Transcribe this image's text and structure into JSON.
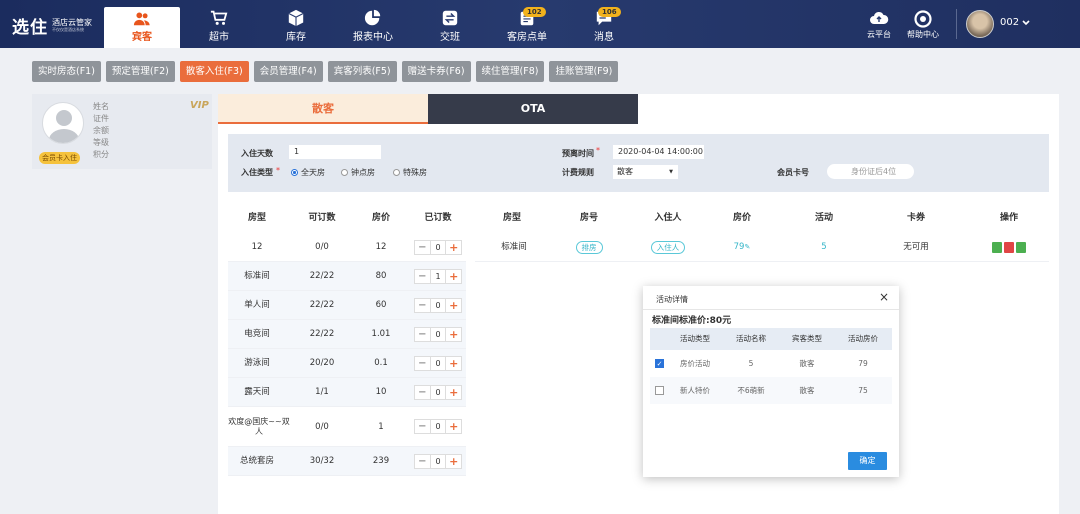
{
  "brand": {
    "logo_big": "选住",
    "logo_name": "酒店云管家",
    "logo_sub": "不仅仅是酒店系统"
  },
  "nav": [
    {
      "label": "宾客",
      "icon": "guests-icon",
      "active": true
    },
    {
      "label": "超市",
      "icon": "cart-icon"
    },
    {
      "label": "库存",
      "icon": "box-icon"
    },
    {
      "label": "报表中心",
      "icon": "pie-chart-icon"
    },
    {
      "label": "交班",
      "icon": "shift-icon"
    },
    {
      "label": "客房点单",
      "icon": "room-order-icon",
      "badge": "102"
    },
    {
      "label": "消息",
      "icon": "message-icon",
      "badge": "106"
    }
  ],
  "right_nav": {
    "cloud": "云平台",
    "help": "帮助中心",
    "user": "002"
  },
  "tabs": [
    "实时房态(F1)",
    "预定管理(F2)",
    "散客入住(F3)",
    "会员管理(F4)",
    "宾客列表(F5)",
    "赠送卡券(F6)",
    "续住管理(F8)",
    "挂账管理(F9)"
  ],
  "active_tab": 2,
  "member": {
    "fields": [
      "姓名",
      "证件",
      "余额",
      "等级",
      "积分"
    ],
    "vip": "VIP",
    "badge": "会员卡入住"
  },
  "main_tabs": {
    "walkin": "散客",
    "ota": "OTA"
  },
  "form": {
    "days_label": "入住天数",
    "days_value": "1",
    "type_label": "入住类型",
    "types": [
      {
        "label": "全天房",
        "checked": true
      },
      {
        "label": "钟点房",
        "checked": false
      },
      {
        "label": "特殊房",
        "checked": false
      }
    ],
    "leave_label": "预离时间",
    "leave_value": "2020-04-04 14:00:00",
    "rule_label": "计费规则",
    "rule_value": "散客",
    "card_label": "会员卡号",
    "card_placeholder": "身份证后4位"
  },
  "room_types": {
    "headers": [
      "房型",
      "可订数",
      "房价",
      "已订数"
    ],
    "rows": [
      {
        "type": "12",
        "avail": "0/0",
        "price": "12",
        "booked": "0"
      },
      {
        "type": "标准间",
        "avail": "22/22",
        "price": "80",
        "booked": "1"
      },
      {
        "type": "单人间",
        "avail": "22/22",
        "price": "60",
        "booked": "0"
      },
      {
        "type": "电竞间",
        "avail": "22/22",
        "price": "1.01",
        "booked": "0"
      },
      {
        "type": "游泳间",
        "avail": "20/20",
        "price": "0.1",
        "booked": "0"
      },
      {
        "type": "露天间",
        "avail": "1/1",
        "price": "10",
        "booked": "0"
      },
      {
        "type": "欢度@国庆~~双人",
        "avail": "0/0",
        "price": "1",
        "booked": "0"
      },
      {
        "type": "总统套房",
        "avail": "30/32",
        "price": "239",
        "booked": "0"
      }
    ]
  },
  "selected": {
    "headers": [
      "房型",
      "房号",
      "入住人",
      "房价",
      "活动",
      "卡券",
      "操作"
    ],
    "row": {
      "type": "标准间",
      "room": "排房",
      "guest": "入住人",
      "price": "79",
      "activity": "5",
      "coupon": "无可用"
    }
  },
  "modal": {
    "title": "活动详情",
    "subtitle": "标准间标准价:80元",
    "headers": [
      "活动类型",
      "活动名称",
      "宾客类型",
      "活动房价"
    ],
    "rows": [
      {
        "checked": true,
        "type": "房价活动",
        "name": "5",
        "guest": "散客",
        "price": "79"
      },
      {
        "checked": false,
        "type": "新人特价",
        "name": "不6萌新",
        "guest": "散客",
        "price": "75"
      }
    ],
    "ok": "确定",
    "close": "×"
  },
  "colors": {
    "accent": "#ea6d3c",
    "nav_bg": "#1b2c5e",
    "primary": "#2a8ce0"
  }
}
